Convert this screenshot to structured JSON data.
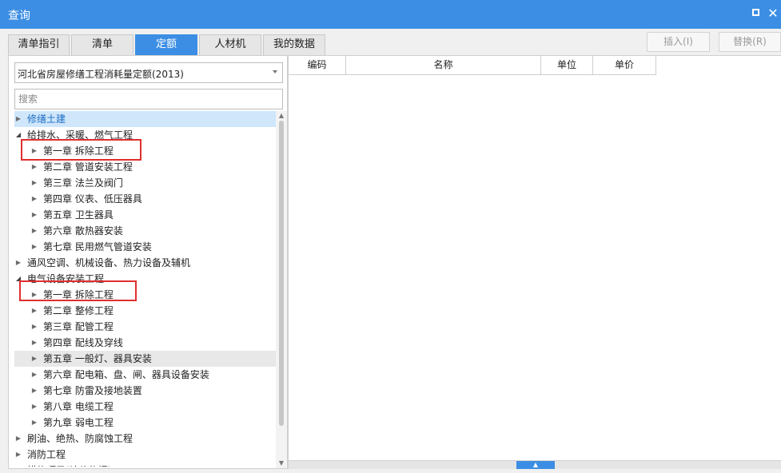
{
  "window": {
    "title": "查询"
  },
  "tabs": [
    {
      "label": "清单指引",
      "active": false
    },
    {
      "label": "清单",
      "active": false
    },
    {
      "label": "定额",
      "active": true
    },
    {
      "label": "人材机",
      "active": false
    },
    {
      "label": "我的数据",
      "active": false
    }
  ],
  "toolbar": {
    "insert_label": "插入(I)",
    "replace_label": "替换(R)"
  },
  "library_select": {
    "value": "河北省房屋修缮工程消耗量定额(2013)"
  },
  "search": {
    "placeholder": "搜索"
  },
  "tree": [
    {
      "label": "修缮土建",
      "state": "collapsed",
      "selected": true
    },
    {
      "label": "给排水、采暖、燃气工程",
      "state": "expanded"
    },
    {
      "label": "第一章 拆除工程",
      "state": "collapsed"
    },
    {
      "label": "第二章 管道安装工程",
      "state": "collapsed"
    },
    {
      "label": "第三章 法兰及阀门",
      "state": "collapsed"
    },
    {
      "label": "第四章 仪表、低压器具",
      "state": "collapsed"
    },
    {
      "label": "第五章 卫生器具",
      "state": "collapsed"
    },
    {
      "label": "第六章 散热器安装",
      "state": "collapsed"
    },
    {
      "label": "第七章 民用燃气管道安装",
      "state": "collapsed"
    },
    {
      "label": "通风空调、机械设备、热力设备及辅机",
      "state": "collapsed"
    },
    {
      "label": "电气设备安装工程",
      "state": "expanded"
    },
    {
      "label": "第一章 拆除工程",
      "state": "collapsed"
    },
    {
      "label": "第二章 整修工程",
      "state": "collapsed"
    },
    {
      "label": "第三章 配管工程",
      "state": "collapsed"
    },
    {
      "label": "第四章 配线及穿线",
      "state": "collapsed"
    },
    {
      "label": "第五章 一般灯、器具安装",
      "state": "collapsed",
      "hovered": true
    },
    {
      "label": "第六章 配电箱、盘、闸、器具设备安装",
      "state": "collapsed"
    },
    {
      "label": "第七章 防雷及接地装置",
      "state": "collapsed"
    },
    {
      "label": "第八章 电缆工程",
      "state": "collapsed"
    },
    {
      "label": "第九章 弱电工程",
      "state": "collapsed"
    },
    {
      "label": "刷油、绝热、防腐蚀工程",
      "state": "collapsed"
    },
    {
      "label": "消防工程",
      "state": "collapsed"
    },
    {
      "label": "措施项目(计价依据)",
      "state": "collapsed"
    }
  ],
  "grid": {
    "columns": [
      "编码",
      "名称",
      "单位",
      "单价"
    ]
  },
  "colors": {
    "accent": "#3c8ee4",
    "highlight_box": "#e02f2f"
  }
}
